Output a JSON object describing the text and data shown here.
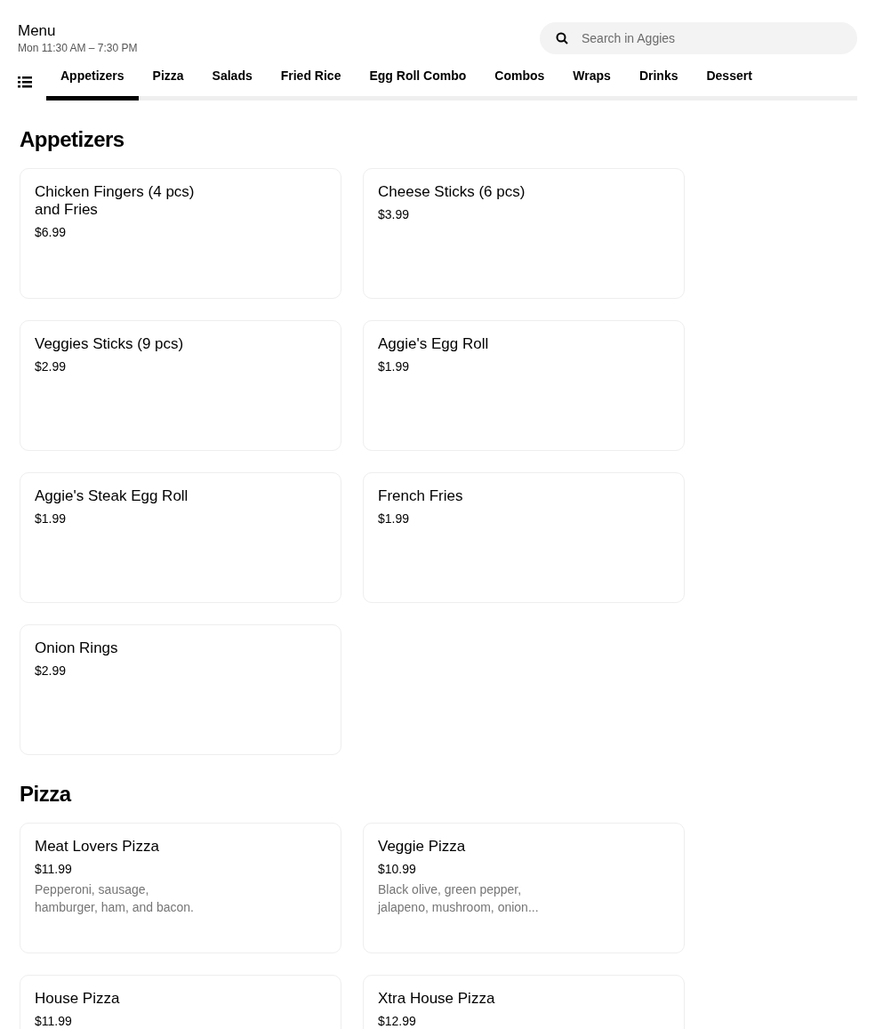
{
  "header": {
    "title": "Menu",
    "hours": "Mon 11:30 AM – 7:30 PM"
  },
  "search": {
    "placeholder": "Search in Aggies"
  },
  "tabs": [
    {
      "label": "Appetizers",
      "selected": true
    },
    {
      "label": "Pizza",
      "selected": false
    },
    {
      "label": "Salads",
      "selected": false
    },
    {
      "label": "Fried Rice",
      "selected": false
    },
    {
      "label": "Egg Roll Combo",
      "selected": false
    },
    {
      "label": "Combos",
      "selected": false
    },
    {
      "label": "Wraps",
      "selected": false
    },
    {
      "label": "Drinks",
      "selected": false
    },
    {
      "label": "Dessert",
      "selected": false
    }
  ],
  "sections": [
    {
      "title": "Appetizers",
      "items": [
        {
          "name": "Chicken Fingers (4 pcs) and Fries",
          "price": "$6.99"
        },
        {
          "name": "Cheese Sticks (6 pcs)",
          "price": "$3.99"
        },
        {
          "name": "Veggies Sticks (9 pcs)",
          "price": "$2.99"
        },
        {
          "name": "Aggie's Egg Roll",
          "price": "$1.99"
        },
        {
          "name": "Aggie's Steak Egg Roll",
          "price": "$1.99"
        },
        {
          "name": "French Fries",
          "price": "$1.99"
        },
        {
          "name": "Onion Rings",
          "price": "$2.99"
        }
      ]
    },
    {
      "title": "Pizza",
      "items": [
        {
          "name": "Meat Lovers Pizza",
          "price": "$11.99",
          "description": "Pepperoni, sausage, hamburger, ham, and bacon."
        },
        {
          "name": "Veggie Pizza",
          "price": "$10.99",
          "description": "Black olive, green pepper, jalapeno, mushroom, onion..."
        },
        {
          "name": "House Pizza",
          "price": "$11.99"
        },
        {
          "name": "Xtra House Pizza",
          "price": "$12.99"
        }
      ]
    }
  ]
}
